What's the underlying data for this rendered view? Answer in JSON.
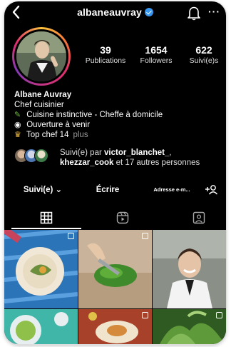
{
  "header": {
    "username": "albaneauvray"
  },
  "stats": [
    {
      "value": "39",
      "label": "Publications"
    },
    {
      "value": "1654",
      "label": "Followers"
    },
    {
      "value": "622",
      "label": "Suivi(e)s"
    }
  ],
  "bio": {
    "name": "Albane Auvray",
    "category": "Chef cuisinier",
    "line1": "Cuisine instinctive - Cheffe à domicile",
    "line2": "Ouverture à venir",
    "line3": "Top chef 14",
    "more": "plus"
  },
  "followed_by": {
    "prefix": "Suivi(e) par ",
    "user1": "victor_blanchet_",
    "sep": ",",
    "user2": "khezzar_cook",
    "suffix": " et 17 autres personnes"
  },
  "buttons": {
    "follow": "Suivi(e) ⌄",
    "message": "Écrire",
    "address": "Adresse e-m..."
  },
  "colors": {
    "background": "#000000",
    "verified": "#3897f0",
    "text_secondary": "#dddddd"
  }
}
